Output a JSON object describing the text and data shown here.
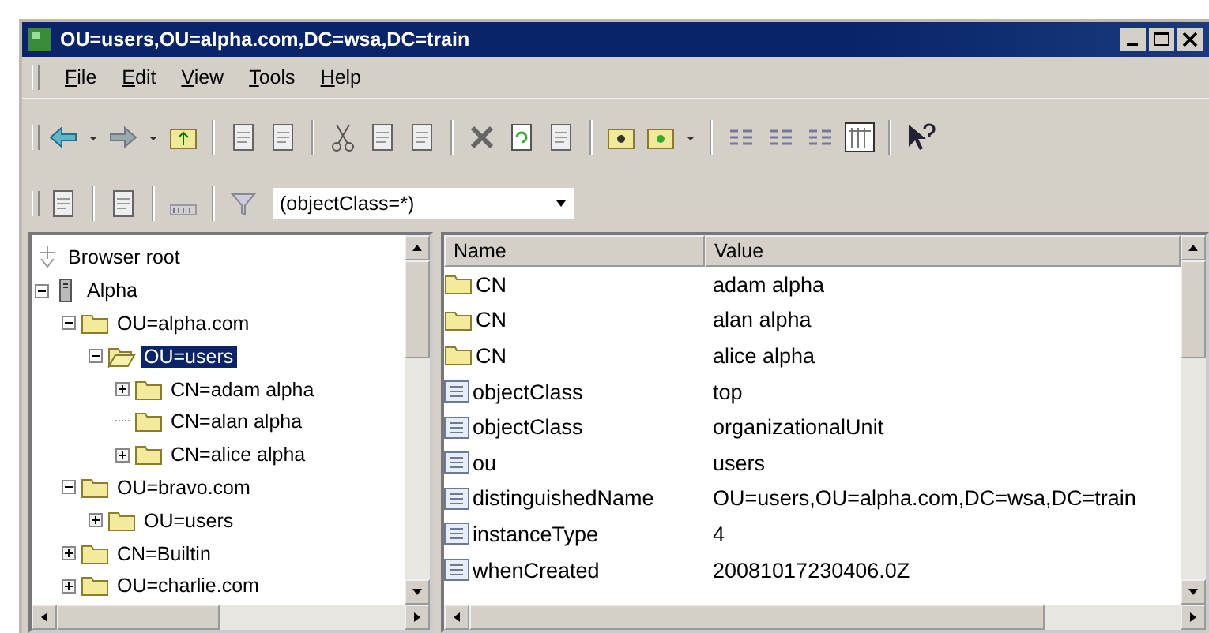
{
  "window": {
    "title": "OU=users,OU=alpha.com,DC=wsa,DC=train"
  },
  "menu": [
    "File",
    "Edit",
    "View",
    "Tools",
    "Help"
  ],
  "filter": {
    "value": "(objectClass=*)"
  },
  "tree": [
    {
      "label": "Browser root",
      "kind": "root",
      "selected": false
    },
    {
      "label": "Alpha",
      "kind": "server",
      "selected": false,
      "expanded": true,
      "children": [
        {
          "label": "OU=alpha.com",
          "kind": "folder",
          "selected": false,
          "expanded": true,
          "children": [
            {
              "label": "OU=users",
              "kind": "folder",
              "selected": true,
              "expanded": true,
              "children": [
                {
                  "label": "CN=adam alpha",
                  "kind": "folder",
                  "selected": false,
                  "expanded": false
                },
                {
                  "label": "CN=alan alpha",
                  "kind": "folder",
                  "selected": false
                },
                {
                  "label": "CN=alice alpha",
                  "kind": "folder",
                  "selected": false,
                  "expanded": false
                }
              ]
            }
          ]
        },
        {
          "label": "OU=bravo.com",
          "kind": "folder",
          "selected": false,
          "expanded": true,
          "children": [
            {
              "label": "OU=users",
              "kind": "folder",
              "selected": false,
              "expanded": false
            }
          ]
        },
        {
          "label": "CN=Builtin",
          "kind": "folder",
          "selected": false,
          "expanded": false
        },
        {
          "label": "OU=charlie.com",
          "kind": "folder",
          "selected": false,
          "expanded": false
        }
      ]
    }
  ],
  "table": {
    "columns": [
      "Name",
      "Value"
    ],
    "rows": [
      {
        "kind": "container",
        "name": "CN",
        "value": "adam alpha"
      },
      {
        "kind": "container",
        "name": "CN",
        "value": "alan alpha"
      },
      {
        "kind": "container",
        "name": "CN",
        "value": "alice alpha"
      },
      {
        "kind": "attribute",
        "name": "objectClass",
        "value": "top"
      },
      {
        "kind": "attribute",
        "name": "objectClass",
        "value": "organizationalUnit"
      },
      {
        "kind": "attribute",
        "name": "ou",
        "value": "users"
      },
      {
        "kind": "attribute",
        "name": "distinguishedName",
        "value": "OU=users,OU=alpha.com,DC=wsa,DC=train"
      },
      {
        "kind": "attribute",
        "name": "instanceType",
        "value": "4"
      },
      {
        "kind": "attribute",
        "name": "whenCreated",
        "value": "20081017230406.0Z"
      }
    ]
  }
}
